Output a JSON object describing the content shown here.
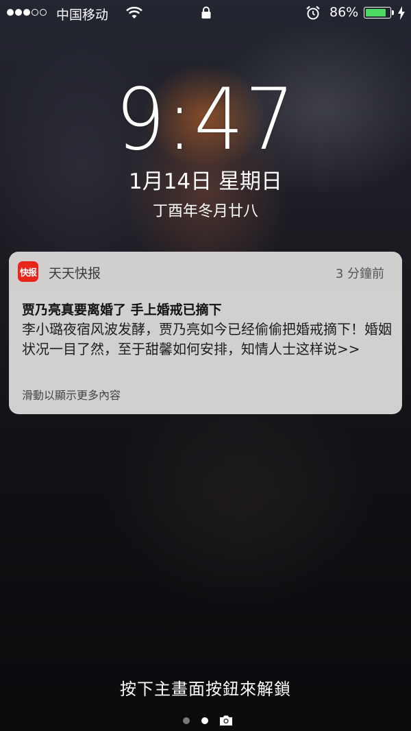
{
  "status_bar": {
    "signal_bars": [
      true,
      true,
      true,
      false,
      false
    ],
    "carrier": "中国移动",
    "battery_percent": "86%",
    "battery_level": 0.86,
    "battery_color": "#4cd964",
    "icons": [
      "wifi-icon",
      "lock-icon",
      "alarm-icon",
      "battery-icon",
      "charging-icon"
    ]
  },
  "clock": {
    "time": "9:47",
    "date": "1月14日 星期日",
    "lunar_date": "丁酉年冬月廿八"
  },
  "notification": {
    "app_icon_text": "快报",
    "app_icon_color": "#e8261c",
    "app_name": "天天快报",
    "time_ago": "3 分鐘前",
    "title": "贾乃亮真要离婚了 手上婚戒已摘下",
    "body": "李小璐夜宿风波发酵，贾乃亮如今已经偷偷把婚戒摘下！婚姻状况一目了然，至于甜馨如何安排，知情人士这样说>>",
    "more_hint": "滑動以顯示更多內容"
  },
  "bottom": {
    "unlock_hint": "按下主畫面按鈕來解鎖",
    "page_dots": 2,
    "active_page": 1
  }
}
